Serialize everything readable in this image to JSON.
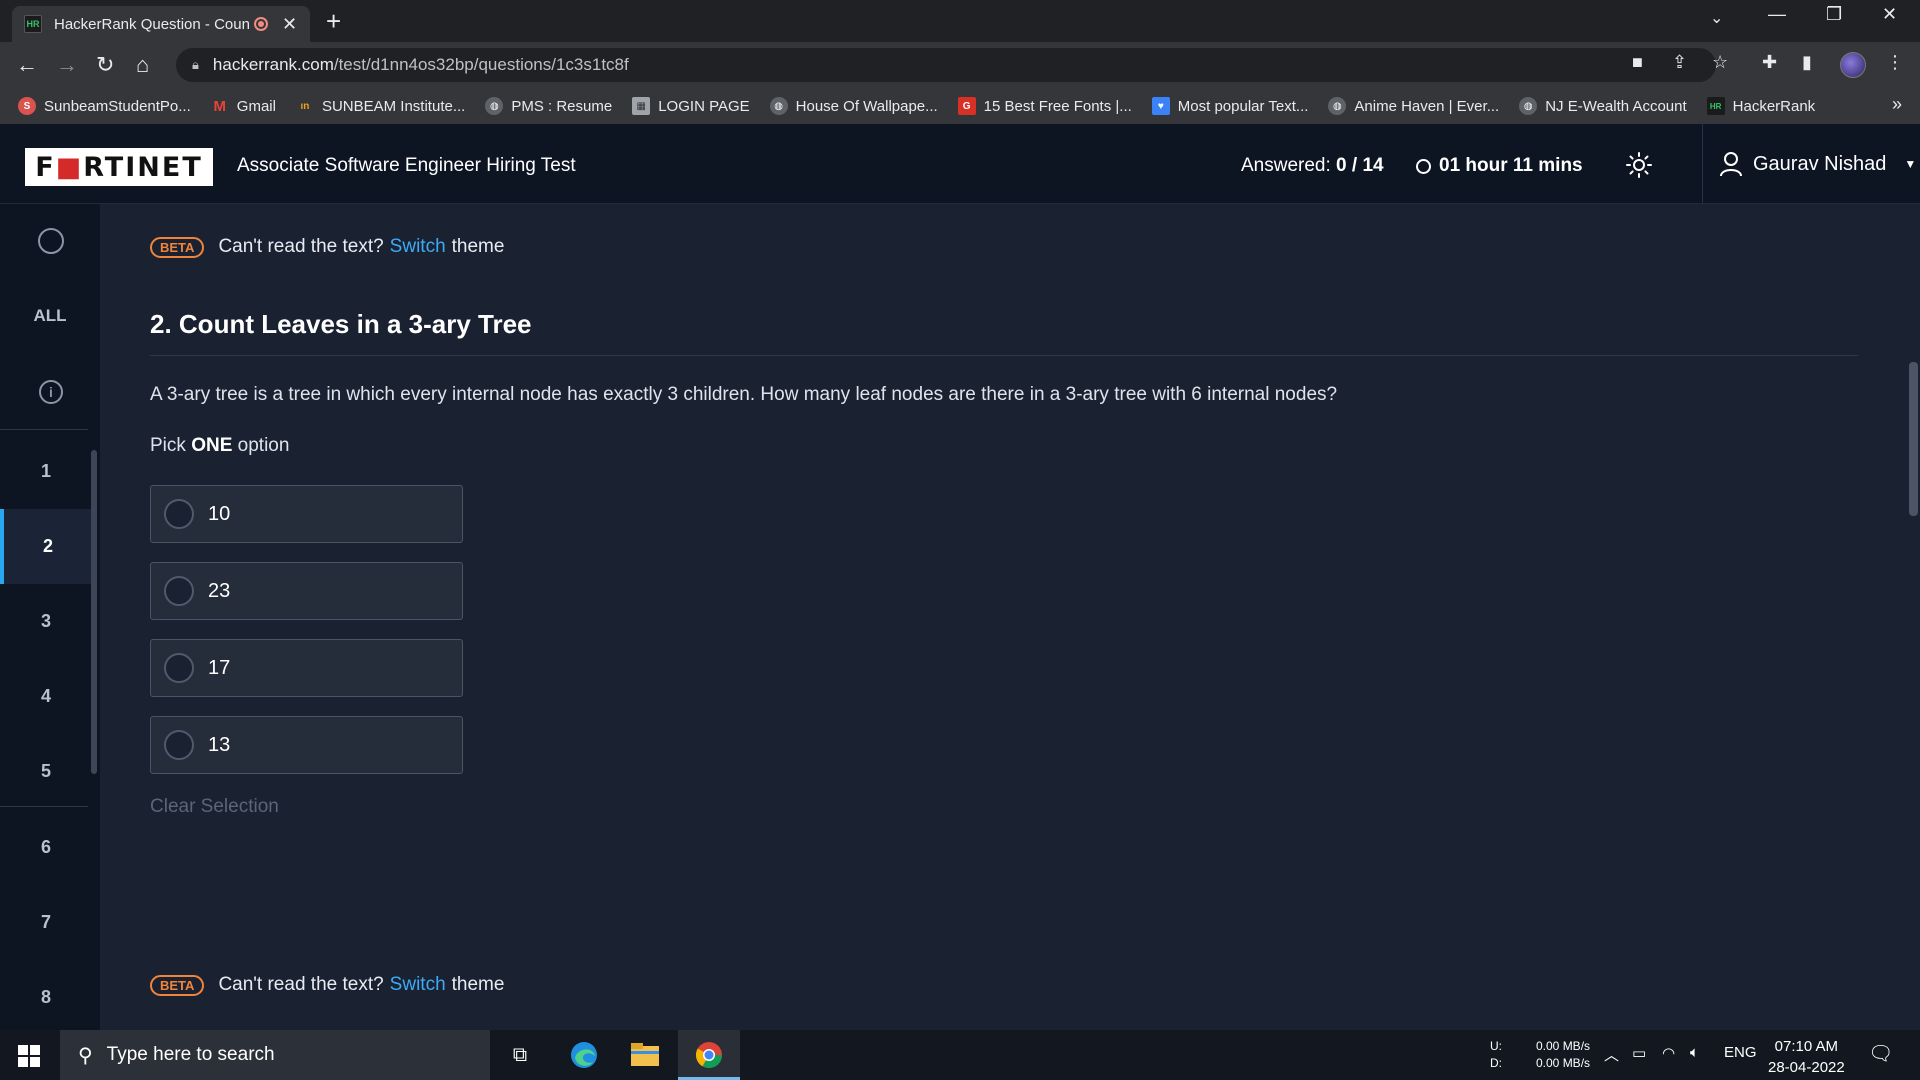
{
  "browser": {
    "tab_title": "HackerRank Question - Coun",
    "tab_favicon": "HR",
    "url_domain": "hackerrank.com",
    "url_path": "/test/d1nn4os32bp/questions/1c3s1tc8f",
    "bookmarks": [
      {
        "label": "SunbeamStudentPo...",
        "icon": "sunbeam-icon",
        "color": "#d9534f"
      },
      {
        "label": "Gmail",
        "icon": "gmail-icon",
        "color": "#ea4335"
      },
      {
        "label": "SUNBEAM Institute...",
        "icon": "sunbeam-institute-icon",
        "color": "#f0a020"
      },
      {
        "label": "PMS : Resume",
        "icon": "globe-icon",
        "color": "#8a8f98"
      },
      {
        "label": "LOGIN PAGE",
        "icon": "login-page-icon",
        "color": "#a0a4aa"
      },
      {
        "label": "House Of Wallpape...",
        "icon": "globe-icon",
        "color": "#8a8f98"
      },
      {
        "label": "15 Best Free Fonts |...",
        "icon": "gdj-icon",
        "color": "#d93025"
      },
      {
        "label": "Most popular Text...",
        "icon": "heart-icon",
        "color": "#3b82f6"
      },
      {
        "label": "Anime Haven | Ever...",
        "icon": "globe-icon",
        "color": "#8a8f98"
      },
      {
        "label": "NJ E-Wealth Account",
        "icon": "globe-icon",
        "color": "#8a8f98"
      },
      {
        "label": "HackerRank",
        "icon": "hackerrank-icon",
        "color": "#2ec866"
      }
    ]
  },
  "header": {
    "logo": "FORTINET",
    "test_title": "Associate Software Engineer Hiring Test",
    "answered_label": "Answered: ",
    "answered_value": "0 / 14",
    "timer": "01 hour 11 mins",
    "user_name": "Gaurav Nishad"
  },
  "sidebar": {
    "all_label": "ALL",
    "questions": [
      "1",
      "2",
      "3",
      "4",
      "5",
      "6",
      "7",
      "8"
    ],
    "active_question": "2"
  },
  "beta_banner": {
    "badge": "BETA",
    "text_before": "Can't read the text?",
    "link": "Switch",
    "text_after": "theme"
  },
  "question": {
    "title": "2. Count Leaves in a 3-ary Tree",
    "text": "A 3-ary tree is a tree in which every internal node has exactly 3 children.  How many leaf nodes are there in a 3-ary tree with 6 internal nodes?",
    "pick_prefix": "Pick ",
    "pick_bold": "ONE",
    "pick_suffix": " option",
    "options": [
      "10",
      "23",
      "17",
      "13"
    ],
    "clear_label": "Clear Selection"
  },
  "taskbar": {
    "search_placeholder": "Type here to search",
    "net_up_label": "U:",
    "net_down_label": "D:",
    "net_up": "0.00 MB/s",
    "net_down": "0.00 MB/s",
    "language": "ENG",
    "time": "07:10 AM",
    "date": "28-04-2022"
  },
  "colors": {
    "accent": "#29a8f0",
    "beta": "#f0843a",
    "link": "#3ea9f5",
    "page_bg": "#1a2232",
    "header_bg": "#0d1522"
  }
}
